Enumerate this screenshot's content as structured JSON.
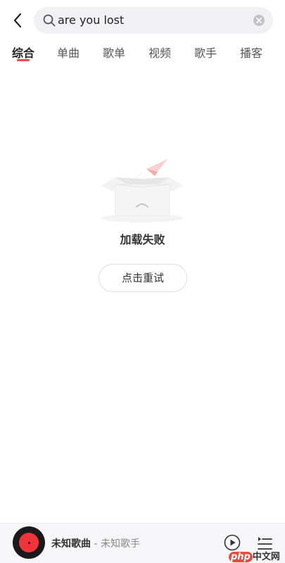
{
  "search": {
    "query": "are you lost"
  },
  "tabs": [
    {
      "label": "综合",
      "active": true
    },
    {
      "label": "单曲",
      "active": false
    },
    {
      "label": "歌单",
      "active": false
    },
    {
      "label": "视频",
      "active": false
    },
    {
      "label": "歌手",
      "active": false
    },
    {
      "label": "播客",
      "active": false
    }
  ],
  "empty_state": {
    "message": "加载失败",
    "retry_label": "点击重试"
  },
  "player": {
    "song_title": "未知歌曲",
    "separator": " - ",
    "artist": "未知歌手"
  },
  "watermark": {
    "brand": "php",
    "suffix": "中文网"
  },
  "colors": {
    "accent": "#f24b4b",
    "disc_label": "#f0343a"
  },
  "icons": [
    "back-icon",
    "search-icon",
    "clear-icon",
    "play-icon",
    "playlist-icon"
  ]
}
